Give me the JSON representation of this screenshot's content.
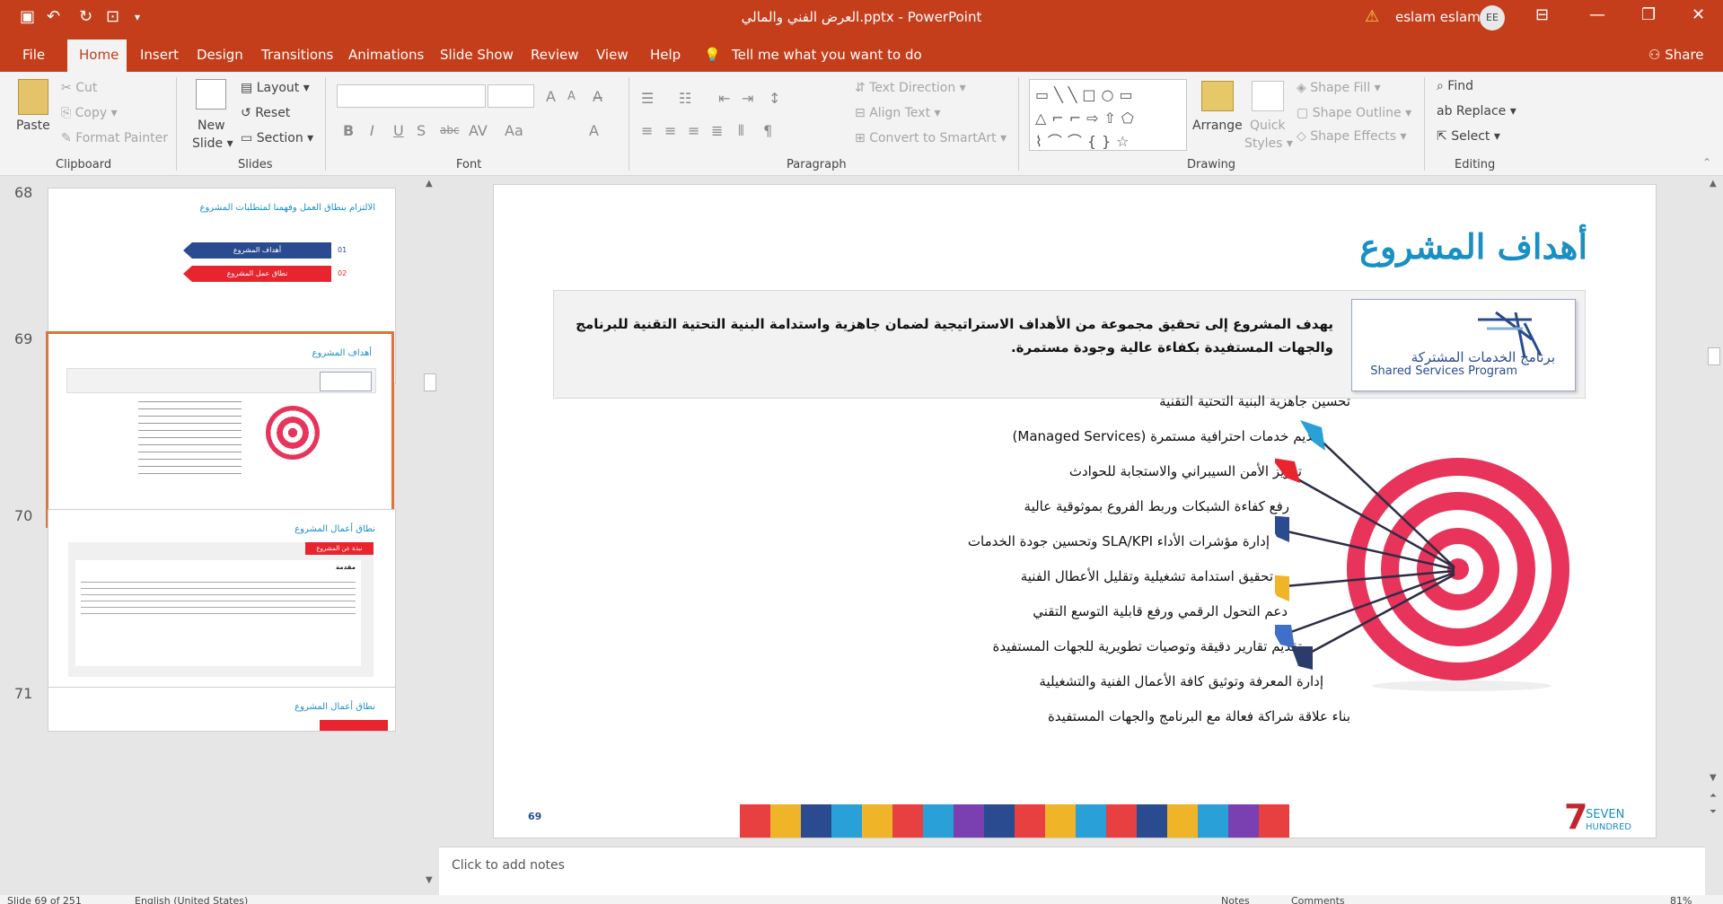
{
  "titlebar": {
    "doc_title": "العرض الفني   والمالي.pptx  -  PowerPoint",
    "user": "eslam eslam",
    "initials": "EE"
  },
  "tabs": [
    "File",
    "Home",
    "Insert",
    "Design",
    "Transitions",
    "Animations",
    "Slide Show",
    "Review",
    "View",
    "Help"
  ],
  "tell_me": "Tell me what you want to do",
  "share": "Share",
  "ribbon": {
    "clipboard": {
      "paste": "Paste",
      "cut": "Cut",
      "copy": "Copy",
      "format_painter": "Format Painter",
      "label": "Clipboard"
    },
    "slides": {
      "new_slide_1": "New",
      "new_slide_2": "Slide",
      "layout": "Layout",
      "reset": "Reset",
      "section": "Section",
      "label": "Slides"
    },
    "font": {
      "label": "Font"
    },
    "paragraph": {
      "text_direction": "Text Direction",
      "align_text": "Align Text",
      "convert_smartart": "Convert to SmartArt",
      "label": "Paragraph"
    },
    "drawing": {
      "arrange": "Arrange",
      "quick_styles_1": "Quick",
      "quick_styles_2": "Styles",
      "shape_fill": "Shape Fill",
      "shape_outline": "Shape Outline",
      "shape_effects": "Shape Effects",
      "label": "Drawing"
    },
    "editing": {
      "find": "Find",
      "replace": "Replace",
      "select": "Select",
      "label": "Editing"
    }
  },
  "thumbnails": [
    {
      "num": "68",
      "title": "الالتزام بنطاق العمل وفهمنا لمتطلبات المشروع"
    },
    {
      "num": "69",
      "title": "أهداف المشروع"
    },
    {
      "num": "70",
      "title": "نطاق أعمال المشروع"
    },
    {
      "num": "71",
      "title": "نطاق أعمال المشروع"
    }
  ],
  "thumb68": {
    "item1": "أهداف المشروع",
    "item2": "نطاق عمل المشروع",
    "n1": "01",
    "n2": "02"
  },
  "thumb70": {
    "badge": "نبذة عن المشروع",
    "heading": "مقدمة"
  },
  "slide": {
    "title": "أهداف المشروع",
    "intro": "يهدف المشروع إلى تحقيق مجموعة من الأهداف الاستراتيجية لضمان جاهزية واستدامة البنية التحتية التقنية للبرنامج والجهات المستفيدة بكفاءة عالية وجودة مستمرة.",
    "logo_ar": "برنامج الخدمات المشتركة",
    "logo_en": "Shared Services Program",
    "goals": [
      "تحسين جاهزية البنية التحتية التقنية",
      "تقديم خدمات احترافية مستمرة (Managed Services)",
      "تعزيز الأمن السيبراني والاستجابة للحوادث",
      "رفع كفاءة الشبكات وربط الفروع بموثوقية عالية",
      "إدارة مؤشرات الأداء SLA/KPI وتحسين جودة الخدمات",
      "تحقيق استدامة تشغيلية وتقليل الأعطال الفنية",
      "دعم التحول الرقمي ورفع قابلية التوسع التقني",
      "تقديم تقارير دقيقة وتوصيات تطويرية للجهات المستفيدة",
      "إدارة المعرفة وتوثيق كافة الأعمال الفنية والتشغيلية",
      "بناء علاقة شراكة فعالة مع البرنامج والجهات المستفيدة"
    ],
    "number": "69",
    "brand_1": "SEVEN",
    "brand_2": "HUNDRED",
    "brand_num": "7"
  },
  "notes_placeholder": "Click to add notes",
  "status": {
    "slide": "Slide 69 of 251",
    "language": "English (United States)",
    "notes": "Notes",
    "comments": "Comments",
    "zoom": "81%"
  },
  "colors": {
    "accent": "#c43e1c",
    "title_blue": "#1a8fc4",
    "navy": "#2a4b8f",
    "target_red": "#e8335a"
  }
}
